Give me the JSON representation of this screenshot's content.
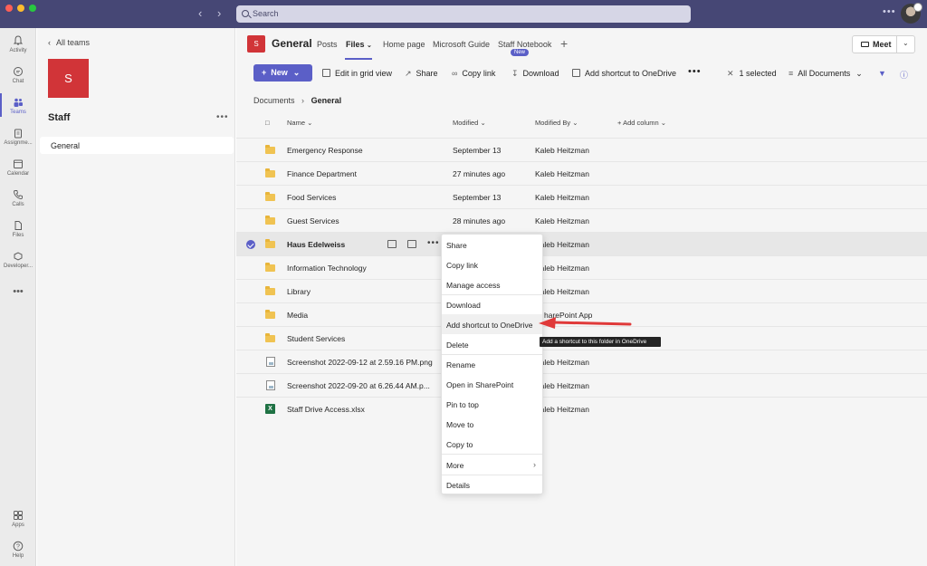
{
  "titlebar": {
    "search_placeholder": "Search"
  },
  "rail": {
    "items": [
      {
        "label": "Activity",
        "icon": "bell-icon"
      },
      {
        "label": "Chat",
        "icon": "chat-icon"
      },
      {
        "label": "Teams",
        "icon": "teams-icon",
        "active": true
      },
      {
        "label": "Assignme...",
        "icon": "assignments-icon"
      },
      {
        "label": "Calendar",
        "icon": "calendar-icon"
      },
      {
        "label": "Calls",
        "icon": "phone-icon"
      },
      {
        "label": "Files",
        "icon": "file-icon"
      },
      {
        "label": "Developer...",
        "icon": "developer-icon"
      },
      {
        "label": "Apps",
        "icon": "apps-icon"
      },
      {
        "label": "Help",
        "icon": "help-icon"
      }
    ]
  },
  "leftpanel": {
    "back_label": "All teams",
    "team_initial": "S",
    "team_name": "Staff",
    "channel": "General"
  },
  "header": {
    "channel_initial": "S",
    "channel_title": "General",
    "tabs": [
      "Posts",
      "Files",
      "Home page",
      "Microsoft Guide",
      "Staff Notebook"
    ],
    "active_tab": "Files",
    "new_badge": "New",
    "meet_label": "Meet"
  },
  "toolbar": {
    "new_label": "New",
    "edit_grid": "Edit in grid view",
    "share": "Share",
    "copy_link": "Copy link",
    "download": "Download",
    "add_shortcut": "Add shortcut to OneDrive",
    "selected_count": "1 selected",
    "view": "All Documents"
  },
  "breadcrumb": {
    "root": "Documents",
    "current": "General"
  },
  "columns": {
    "name": "Name",
    "modified": "Modified",
    "modified_by": "Modified By",
    "add_column": "Add column"
  },
  "files": [
    {
      "name": "Emergency Response",
      "type": "folder",
      "modified": "September 13",
      "by": "Kaleb Heitzman"
    },
    {
      "name": "Finance Department",
      "type": "folder",
      "modified": "27 minutes ago",
      "by": "Kaleb Heitzman"
    },
    {
      "name": "Food Services",
      "type": "folder",
      "modified": "September 13",
      "by": "Kaleb Heitzman"
    },
    {
      "name": "Guest Services",
      "type": "folder",
      "modified": "28 minutes ago",
      "by": "Kaleb Heitzman"
    },
    {
      "name": "Haus Edelweiss",
      "type": "folder",
      "modified": "",
      "by": "Kaleb Heitzman",
      "selected": true
    },
    {
      "name": "Information Technology",
      "type": "folder",
      "modified": "",
      "by": "Kaleb Heitzman"
    },
    {
      "name": "Library",
      "type": "folder",
      "modified": "",
      "by": "Kaleb Heitzman"
    },
    {
      "name": "Media",
      "type": "folder",
      "modified": "",
      "by": "harePoint App"
    },
    {
      "name": "Student Services",
      "type": "folder",
      "modified": "",
      "by": ""
    },
    {
      "name": "Screenshot 2022-09-12 at 2.59.16 PM.png",
      "type": "image",
      "modified": "",
      "by": "Kaleb Heitzman"
    },
    {
      "name": "Screenshot 2022-09-20 at 6.26.44 AM.p...",
      "type": "image",
      "modified": "",
      "by": "Kaleb Heitzman"
    },
    {
      "name": "Staff Drive Access.xlsx",
      "type": "excel",
      "modified": "",
      "by": "Kaleb Heitzman"
    }
  ],
  "context_menu": {
    "items": [
      "Share",
      "Copy link",
      "Manage access",
      "Download",
      "Add shortcut to OneDrive",
      "Delete",
      "Rename",
      "Open in SharePoint",
      "Pin to top",
      "Move to",
      "Copy to",
      "More",
      "Details"
    ]
  },
  "tooltip": "Add a shortcut to this folder in OneDrive",
  "colors": {
    "brand": "#5b5fc7",
    "titlebar": "#464775",
    "team": "#d13438",
    "arrow": "#e03a3a"
  }
}
